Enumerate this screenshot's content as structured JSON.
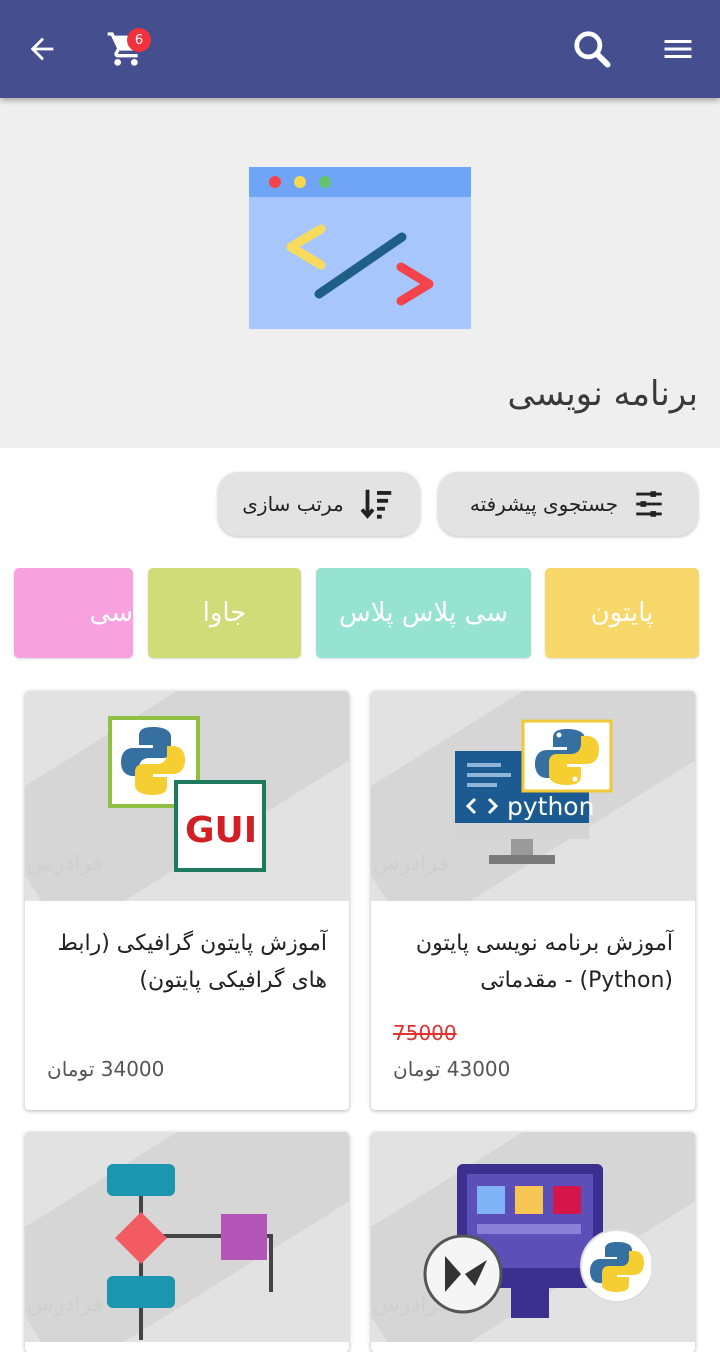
{
  "header": {
    "cart_count": "6"
  },
  "category": {
    "title": "برنامه نویسی"
  },
  "actions": {
    "advanced_search": "جستجوی پیشرفته",
    "sort": "مرتب سازی"
  },
  "chips": [
    {
      "label": "پایتون",
      "color": "#f8d86b"
    },
    {
      "label": "سی پلاس پلاس",
      "color": "#96e3d2"
    },
    {
      "label": "جاوا",
      "color": "#cfdc78"
    },
    {
      "label": "سی",
      "color": "#f7a1de"
    }
  ],
  "products": [
    {
      "title": "آموزش برنامه نویسی پایتون (Python) - مقدماتی",
      "old_price": "75000",
      "price": "43000 تومان"
    },
    {
      "title": "آموزش پایتون گرافیکی (رابط های گرافیکی پایتون)",
      "price": "34000 تومان"
    }
  ],
  "watermark": "فرادرس",
  "icon_text": {
    "python": "python",
    "gui": "GUI"
  },
  "colors": {
    "topbar": "#454e8f",
    "badge": "#f0323c",
    "strike": "#e2322f"
  }
}
